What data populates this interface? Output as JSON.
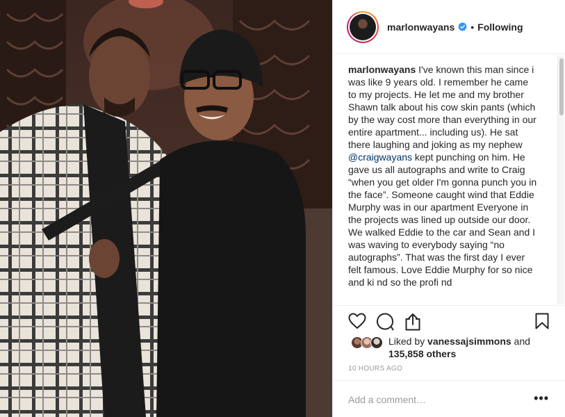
{
  "post": {
    "username": "marlonwayans",
    "verified": true,
    "separator": "•",
    "follow_label": "Following",
    "caption": {
      "user": "marlonwayans",
      "text_part1": " I've known this man since i was like 9 years old. I remember he came to my projects. He let me and my brother Shawn talk about his cow skin pants (which by the way cost more than everything in our entire apartment... including us). He sat there laughing and joking as my nephew ",
      "mention": "@craigwayans",
      "text_part2": " kept punching on him. He gave us all autographs and write to Craig “when you get older I'm gonna punch you in the face”. Someone caught wind that Eddie Murphy was in our apartment Everyone in the projects was lined up outside our door. We walked Eddie to the car and Sean and I was waving to everybody saying “no autographs”. That was the first day I ever felt famous. Love Eddie Murphy for so nice and ki nd so the profi nd"
    },
    "likes": {
      "prefix": "Liked by ",
      "user": "vanessajsimmons",
      "middle": " and ",
      "count": "135,858 others"
    },
    "timestamp": "10 HOURS AGO",
    "comment_placeholder": "Add a comment…",
    "more_label": "•••"
  },
  "icons": {
    "heart": "heart-icon",
    "comment": "comment-icon",
    "share": "share-icon",
    "save": "bookmark-icon",
    "verified": "verified-badge-icon"
  },
  "colors": {
    "text": "#262626",
    "muted": "#999999",
    "mention": "#003569",
    "verified": "#3897f0",
    "border": "#efefef"
  }
}
